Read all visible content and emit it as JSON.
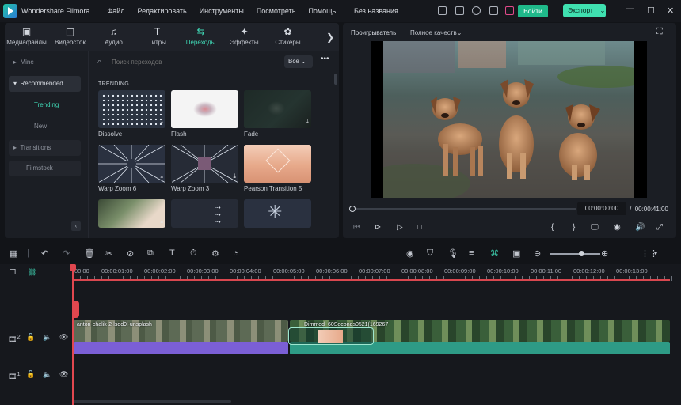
{
  "app": {
    "name": "Wondershare Filmora",
    "doc_title": "Без названия"
  },
  "menu": [
    "Файл",
    "Редактировать",
    "Инструменты",
    "Посмотреть",
    "Помощь"
  ],
  "header": {
    "login_label": "Войти",
    "export_label": "Экспорт",
    "export_caret": "⌄"
  },
  "tabs": [
    {
      "label": "Медиафайлы",
      "icon": "▣"
    },
    {
      "label": "Видеосток",
      "icon": "◫"
    },
    {
      "label": "Аудио",
      "icon": "♫"
    },
    {
      "label": "Титры",
      "icon": "T"
    },
    {
      "label": "Переходы",
      "icon": "⇆"
    },
    {
      "label": "Эффекты",
      "icon": "✦"
    },
    {
      "label": "Стикеры",
      "icon": "✿"
    }
  ],
  "tabs_next": "❯",
  "sidebar": {
    "items": [
      {
        "label": "Mine",
        "caret": "▸"
      },
      {
        "label": "Recommended",
        "caret": "▾"
      },
      {
        "label": "Transitions",
        "caret": "▸"
      },
      {
        "label": "Filmstock",
        "caret": ""
      }
    ],
    "subitems": [
      "Trending",
      "New"
    ],
    "collapse": "‹"
  },
  "browser": {
    "search_placeholder": "Поиск переходов",
    "search_icon": "⌕",
    "filter_label": "Все",
    "filter_caret": "⌄",
    "more": "•••",
    "section": "TRENDING",
    "download_icon": "⤓",
    "items": [
      "Dissolve",
      "Flash",
      "Fade",
      "Warp Zoom 6",
      "Warp Zoom 3",
      "Pearson Transition 5"
    ]
  },
  "preview": {
    "label": "Проигрыватель",
    "quality": "Полное качеств",
    "quality_caret": "⌄",
    "time_current": "00:00:00:00",
    "time_separator": "/",
    "time_total": "00:00:41:00",
    "progress": 0.0,
    "controls": {
      "prev": "⏮",
      "step_back": "⊳",
      "play": "▷",
      "stop": "□",
      "mark_in": "{",
      "mark_out": "}",
      "monitor": "🖵",
      "snapshot": "◉",
      "audio": "🔊",
      "fullscreen": "⤢",
      "screen_icon": "⛶"
    }
  },
  "timeline_toolbar": {
    "icons": {
      "layout": "▦",
      "undo": "↶",
      "redo": "↷",
      "delete": "🗑",
      "cut": "✂",
      "tag": "⊘",
      "crop": "⧉",
      "text": "T",
      "speed": "⏱",
      "adjust": "⚙",
      "color": "◔",
      "render": "◉",
      "marker": "⛉",
      "mic": "🎙",
      "captions": "≡",
      "snap": "⌘",
      "ai": "▣",
      "zoom_out": "⊖",
      "zoom_in": "⊕",
      "grid": "⋮⋮",
      "caret": "▾"
    },
    "zoom": 0.6
  },
  "timeline": {
    "ticks": [
      "00:00",
      "00:00:01:00",
      "00:00:02:00",
      "00:00:03:00",
      "00:00:04:00",
      "00:00:05:00",
      "00:00:06:00",
      "00:00:07:00",
      "00:00:08:00",
      "00:00:09:00",
      "00:00:10:00",
      "00:00:11:00",
      "00:00:12:00",
      "00:00:13:00"
    ],
    "tracks": [
      {
        "index": "2",
        "icons": {
          "video": "🎞",
          "lock": "🔓",
          "audio": "🔈",
          "eye": "👁"
        }
      },
      {
        "index": "1",
        "icons": {
          "video": "🎞",
          "lock": "🔓",
          "audio": "🔈",
          "eye": "👁"
        }
      }
    ],
    "head_icons": {
      "copy": "❐",
      "link": "⛓"
    },
    "clips": [
      {
        "title": "anton-chalik-2-lsdd9l-unsplash"
      },
      {
        "title": "Dimmed_60Seconds0521(169267"
      }
    ]
  }
}
